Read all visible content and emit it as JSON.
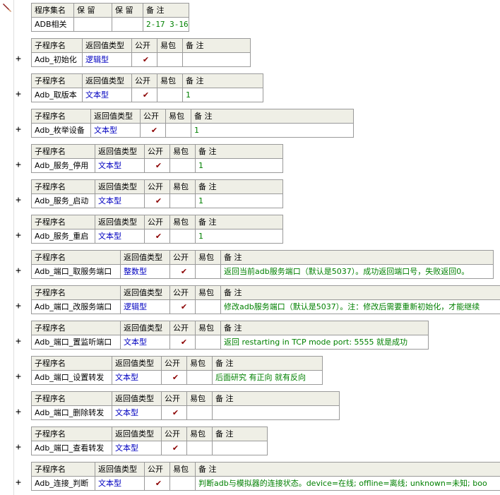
{
  "header": {
    "columns": [
      "程序集名",
      "保 留",
      "保 留",
      "备 注"
    ],
    "row": [
      "ADB相关",
      "",
      "",
      "2-17 3-16"
    ]
  },
  "sub_columns": [
    "子程序名",
    "返回值类型",
    "公开",
    "易包",
    "备 注"
  ],
  "public_mark": "✔",
  "expand_symbol": "+",
  "subroutines": [
    {
      "name": "Adb_初始化",
      "type": "逻辑型",
      "public": true,
      "note": ""
    },
    {
      "name": "Adb_取版本",
      "type": "文本型",
      "public": true,
      "note": "1"
    },
    {
      "name": "Adb_枚举设备",
      "type": "文本型",
      "public": true,
      "note": "1"
    },
    {
      "name": "Adb_服务_停用",
      "type": "文本型",
      "public": true,
      "note": "1"
    },
    {
      "name": "Adb_服务_启动",
      "type": "文本型",
      "public": true,
      "note": "1"
    },
    {
      "name": "Adb_服务_重启",
      "type": "文本型",
      "public": true,
      "note": "1"
    },
    {
      "name": "Adb_端口_取服务端口",
      "type": "整数型",
      "public": true,
      "note": "返回当前adb服务端口（默认是5037）。成功返回端口号，失败返回0。"
    },
    {
      "name": "Adb_端口_改服务端口",
      "type": "逻辑型",
      "public": true,
      "note": "修改adb服务端口（默认是5037）。注：修改后需要重新初始化，才能继续"
    },
    {
      "name": "Adb_端口_置监听端口",
      "type": "文本型",
      "public": true,
      "note": "返回 restarting in TCP mode port: 5555 就是成功"
    },
    {
      "name": "Adb_端口_设置转发",
      "type": "文本型",
      "public": true,
      "note": "后面研究 有正向 就有反向"
    },
    {
      "name": "Adb_端口_删除转发",
      "type": "文本型",
      "public": true,
      "note": ""
    },
    {
      "name": "Adb_端口_查看转发",
      "type": "文本型",
      "public": true,
      "note": ""
    },
    {
      "name": "Adb_连接_判断",
      "type": "文本型",
      "public": true,
      "note": "判断adb与模拟器的连接状态。device=在线; offline=离线; unknown=未知; boo"
    }
  ]
}
